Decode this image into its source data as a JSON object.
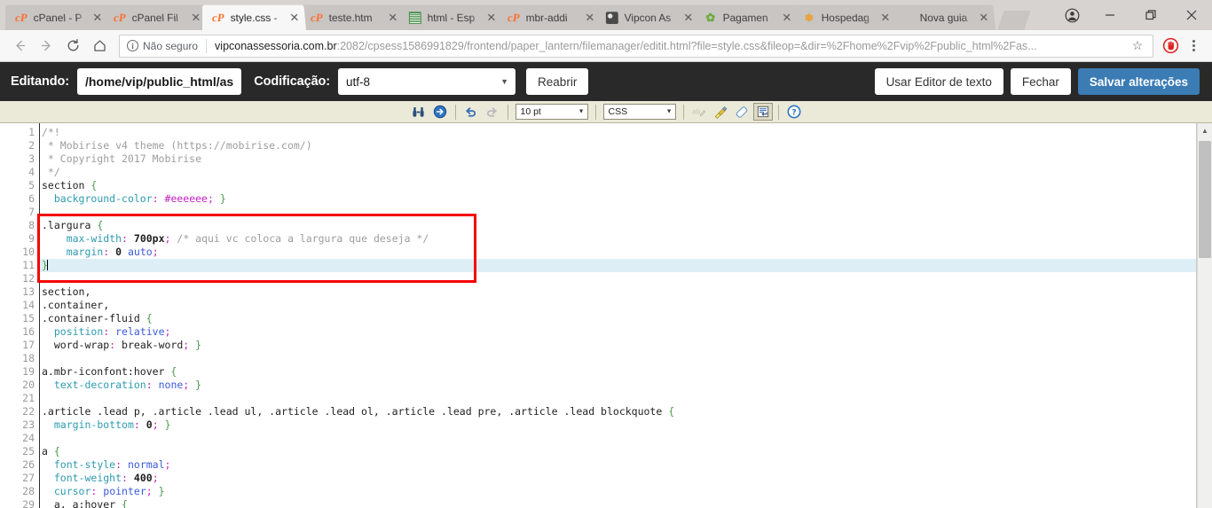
{
  "browser": {
    "tabs": [
      {
        "title": "cPanel - P",
        "favicon": "cpanel-icon",
        "active": false
      },
      {
        "title": "cPanel Fil",
        "favicon": "cpanel-icon",
        "active": false
      },
      {
        "title": "style.css -",
        "favicon": "cpanel-icon",
        "active": true
      },
      {
        "title": "teste.htm",
        "favicon": "cpanel-icon",
        "active": false
      },
      {
        "title": "html - Esp",
        "favicon": "document-green-icon",
        "active": false
      },
      {
        "title": "mbr-addi",
        "favicon": "cpanel-icon",
        "active": false
      },
      {
        "title": "Vipcon As",
        "favicon": "vipcon-icon",
        "active": false
      },
      {
        "title": "Pagamen",
        "favicon": "leaf-green-icon",
        "active": false
      },
      {
        "title": "Hospedag",
        "favicon": "bird-icon",
        "active": false
      },
      {
        "title": "Nova guia",
        "favicon": "none",
        "active": false
      }
    ],
    "new_tab_label": "+",
    "window_controls": {
      "profile": "profile-avatar-icon",
      "minimize": "─",
      "maximize": "❐",
      "close": "✕"
    },
    "nav": {
      "back": "←",
      "forward": "→",
      "reload": "⟳",
      "home": "⌂"
    },
    "omnibox": {
      "security_label": "Não seguro",
      "security_glyph": "i",
      "url_host": "vipconassessoria.com.br",
      "url_rest": ":2082/cpsess1586991829/frontend/paper_lantern/filemanager/editit.html?file=style.css&fileop=&dir=%2Fhome%2Fvip%2Fpublic_html%2Fas...",
      "star": "☆"
    },
    "extension_icon": "adblock-hand-icon",
    "menu_icon": "three-dot-menu-icon"
  },
  "editor_header": {
    "editing_label": "Editando:",
    "file_path": "/home/vip/public_html/as",
    "encoding_label": "Codificação:",
    "encoding_value": "utf-8",
    "reopen_label": "Reabrir",
    "use_text_editor_label": "Usar Editor de texto",
    "close_label": "Fechar",
    "save_label": "Salvar alterações",
    "primary_color": "#3b7cb5"
  },
  "toolbar": {
    "find_icon": "binoculars-find-icon",
    "goto_icon": "goto-line-icon",
    "undo_icon": "undo-icon",
    "redo_icon": "redo-icon",
    "font_size": "10 pt",
    "syntax_mode": "CSS",
    "spellcheck_icon": "spellcheck-ab-icon",
    "brush_icon": "paintbrush-icon",
    "eraser_icon": "eraser-icon",
    "wrap_icon": "line-wrap-icon",
    "help_icon": "help-question-icon"
  },
  "code": {
    "active_line": 11,
    "total_visible_lines": 29,
    "lines": [
      {
        "n": 1,
        "text": "/*!"
      },
      {
        "n": 2,
        "text": " * Mobirise v4 theme (https://mobirise.com/)"
      },
      {
        "n": 3,
        "text": " * Copyright 2017 Mobirise"
      },
      {
        "n": 4,
        "text": " */"
      },
      {
        "n": 5,
        "text": "section {"
      },
      {
        "n": 6,
        "text": "  background-color: #eeeeee; }"
      },
      {
        "n": 7,
        "text": ""
      },
      {
        "n": 8,
        "text": ".largura {"
      },
      {
        "n": 9,
        "text": "    max-width: 700px; /* aqui vc coloca a largura que deseja */"
      },
      {
        "n": 10,
        "text": "    margin: 0 auto;"
      },
      {
        "n": 11,
        "text": "}"
      },
      {
        "n": 12,
        "text": ""
      },
      {
        "n": 13,
        "text": "section,"
      },
      {
        "n": 14,
        "text": ".container,"
      },
      {
        "n": 15,
        "text": ".container-fluid {"
      },
      {
        "n": 16,
        "text": "  position: relative;"
      },
      {
        "n": 17,
        "text": "  word-wrap: break-word; }"
      },
      {
        "n": 18,
        "text": ""
      },
      {
        "n": 19,
        "text": "a.mbr-iconfont:hover {"
      },
      {
        "n": 20,
        "text": "  text-decoration: none; }"
      },
      {
        "n": 21,
        "text": ""
      },
      {
        "n": 22,
        "text": ".article .lead p, .article .lead ul, .article .lead ol, .article .lead pre, .article .lead blockquote {"
      },
      {
        "n": 23,
        "text": "  margin-bottom: 0; }"
      },
      {
        "n": 24,
        "text": ""
      },
      {
        "n": 25,
        "text": "a {"
      },
      {
        "n": 26,
        "text": "  font-style: normal;"
      },
      {
        "n": 27,
        "text": "  font-weight: 400;"
      },
      {
        "n": 28,
        "text": "  cursor: pointer; }"
      },
      {
        "n": 29,
        "text": "  a, a:hover {"
      }
    ]
  },
  "annotation": {
    "shape": "rectangle",
    "color": "#f50000",
    "covers_lines": "8-12"
  }
}
